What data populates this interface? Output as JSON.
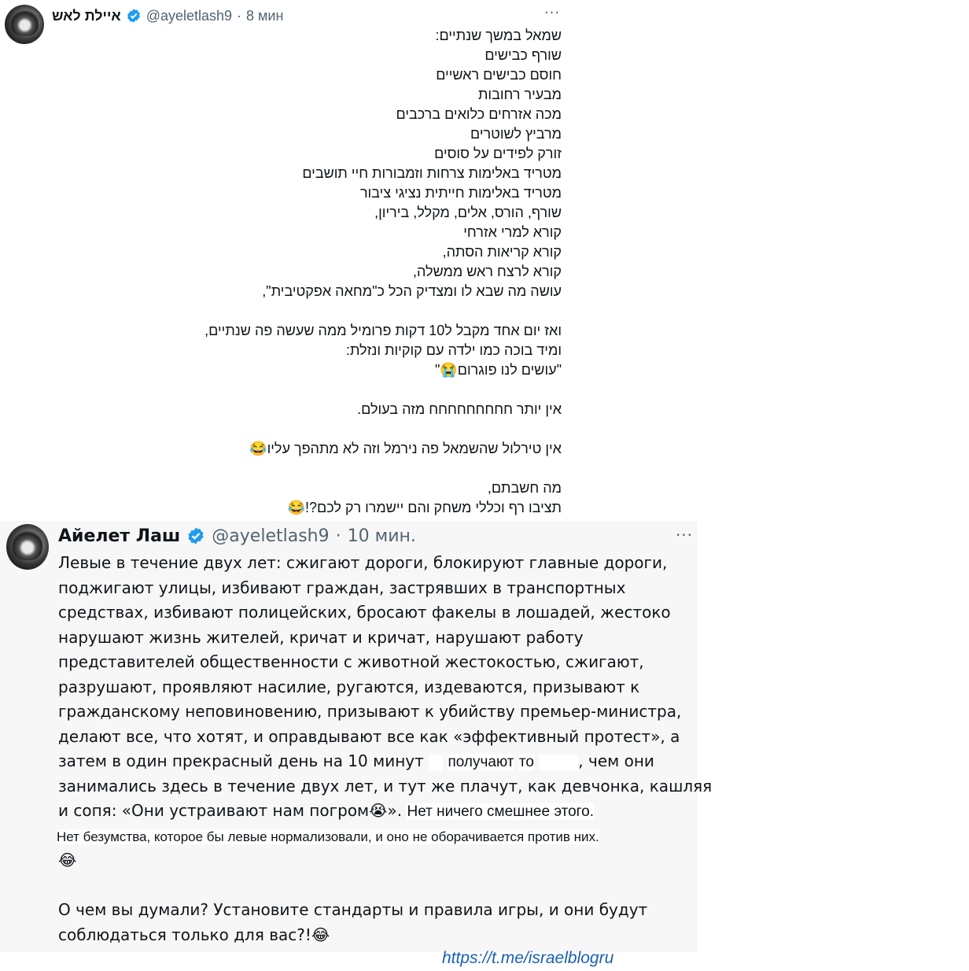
{
  "hebrew_tweet": {
    "name": "איילת לאש",
    "handle": "@ayeletlash9",
    "separator": "·",
    "time": "8 мин",
    "more": "···",
    "lines": [
      "שמאל במשך שנתיים:",
      "שורף כבישים",
      "חוסם כבישים ראשיים",
      "מבעיר רחובות",
      "מכה אזרחים כלואים ברכבים",
      "מרביץ לשוטרים",
      "זורק לפידים על סוסים",
      "מטריד באלימות צרחות וזמבורות חיי תושבים",
      "מטריד באלימות חייתית נציגי ציבור",
      "שורף, הורס, אלים, מקלל, ביריון,",
      "קורא למרי אזרחי",
      "קורא קריאות הסתה,",
      "קורא לרצח ראש ממשלה,",
      "עושה מה שבא לו ומצדיק הכל כ\"מחאה אפקטיבית\",",
      "",
      "ואז יום אחד מקבל ל10 דקות פרומיל ממה שעשה פה שנתיים,",
      "ומיד בוכה כמו ילדה עם קוקיות ונזלת:",
      "\"עושים לנו פוגרום😭\"",
      "",
      "אין יותר חחחחחחחחח מזה בעולם.",
      "",
      "אין טירלול שהשמאל פה נירמל וזה לא מתהפך עליו😂",
      "",
      "מה חשבתם,",
      "תציבו רף וכללי משחק והם יישמרו רק לכם?!😂"
    ]
  },
  "russian_tweet": {
    "name": "Айелет Лаш",
    "handle": "@ayeletlash9",
    "separator": "·",
    "time": "10 мин.",
    "more": "···",
    "lines": [
      "Левые в течение двух лет: сжигают дороги, блокируют главные дороги,",
      "поджигают улицы, избивают граждан, застрявших в транспортных",
      "средствах, избивают полицейских, бросают факелы в лошадей, жестоко",
      "нарушают жизнь жителей, кричат и кричат, нарушают работу",
      "представителей общественности с животной жестокостью, сжигают,",
      "разрушают, проявляют насилие, ругаются, издеваются, призывают к",
      "гражданскому неповиновению, призывают к убийству премьер-министра,",
      "делают все, что хотят, и оправдывают все как «эффективный протест», а"
    ],
    "line9_start": "затем в один прекрасный день на 10 минут",
    "line9_patch_a": "получают",
    "line9_patch_b": "то",
    "line9_end": ", чем они",
    "line10": "занимались здесь в течение двух лет, и тут же плачут, как девчонка, кашляя",
    "line11_start": "и сопя: «Они устраивают нам погром",
    "line11_emoji": "😭",
    "line11_mid": "».",
    "line11_patch": "Нет ничего смешнее этого.",
    "line12_patch": "Нет безумства, которое бы левые нормализовали, и оно не оборачивается против них.",
    "line13_emoji": "😂",
    "line14": "О чем вы думали? Установите стандарты и правила игры, и они будут",
    "line15_text": "соблюдаться только для вас?!",
    "line15_emoji": "😂"
  },
  "footer": {
    "link": "https://t.me/israelblogru"
  },
  "colors": {
    "text": "#0f1419",
    "secondary": "#536471",
    "verified": "#1d9bf0",
    "ru_background": "#f7f7f7",
    "link": "#1a5fb4"
  }
}
